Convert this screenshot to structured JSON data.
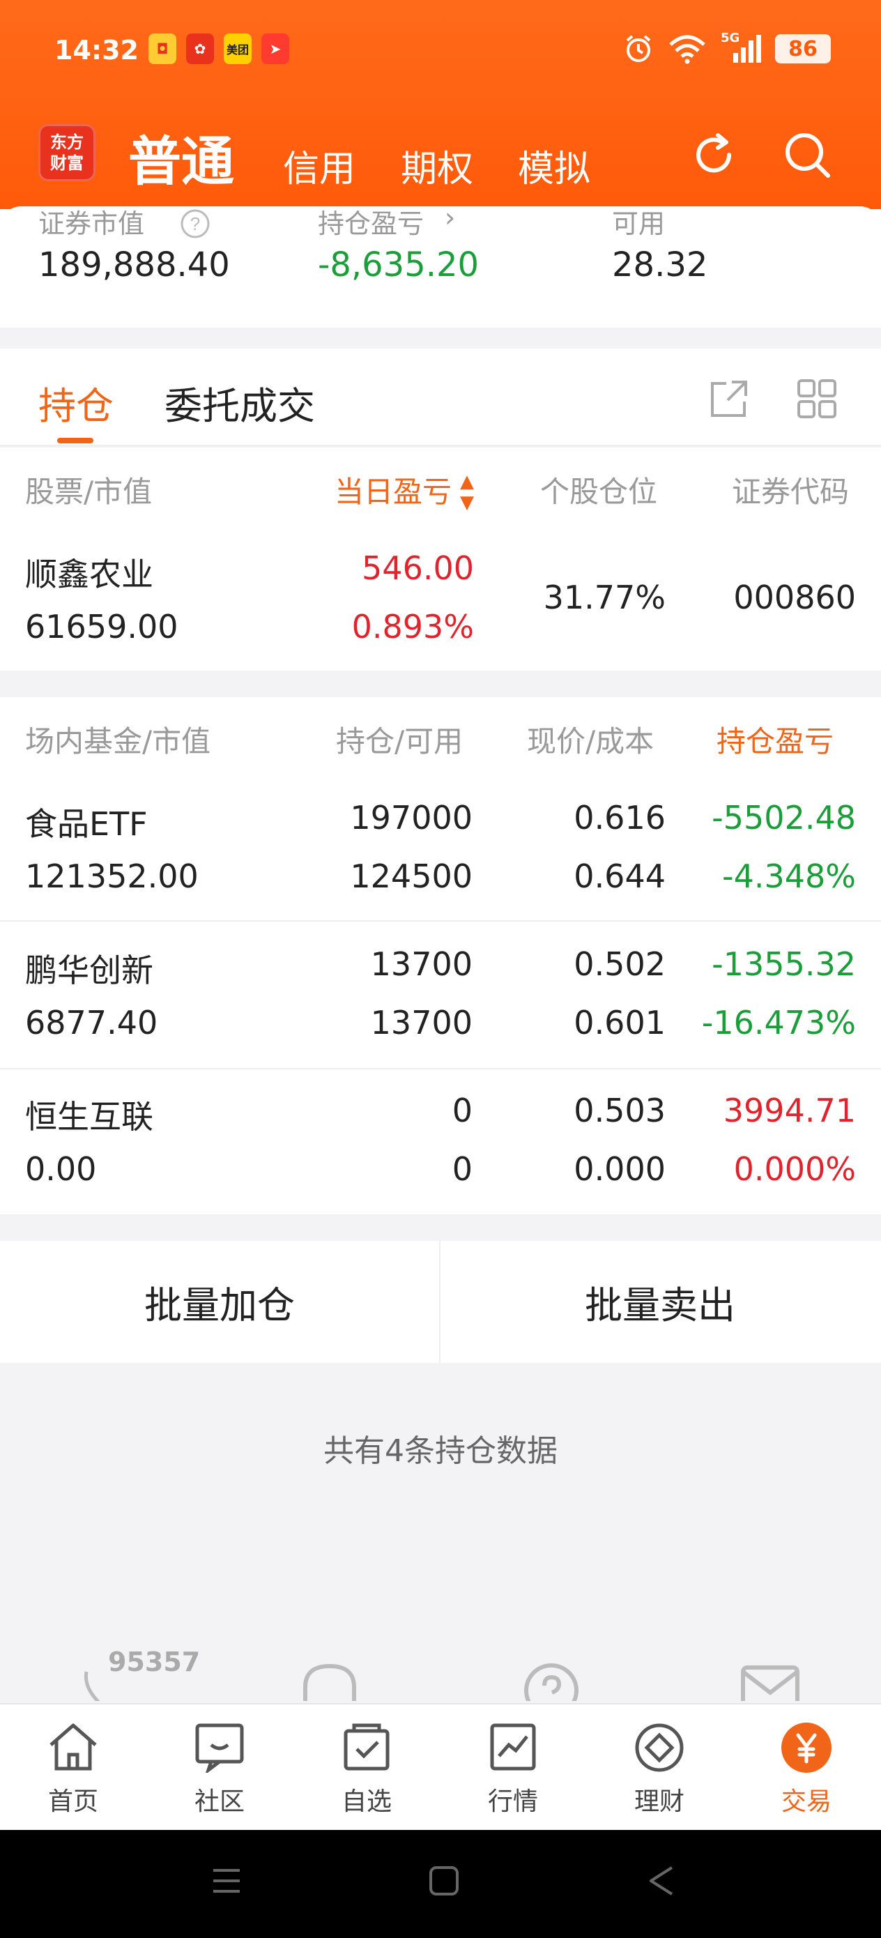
{
  "status_bar": {
    "time": "14:32",
    "network": "5G",
    "battery": "86",
    "apps": [
      "app-1",
      "app-2",
      "美团",
      "app-4"
    ]
  },
  "nav": {
    "logo": "东方财富",
    "main_tab": "普通",
    "tabs": [
      "信用",
      "期权",
      "模拟"
    ]
  },
  "summary": {
    "labels": [
      "证券市值",
      "持仓盈亏",
      "可用"
    ],
    "values": [
      "189,888.40",
      "-8,635.20",
      "28.32"
    ]
  },
  "tabs": {
    "holdings": "持仓",
    "orders": "委托成交"
  },
  "stocks": {
    "headers": [
      "股票/市值",
      "当日盈亏",
      "个股仓位",
      "证券代码"
    ],
    "rows": [
      {
        "name": "顺鑫农业",
        "market_value": "61659.00",
        "day_pnl": "546.00",
        "day_pnl_pct": "0.893%",
        "position_pct": "31.77%",
        "code": "000860"
      }
    ]
  },
  "funds": {
    "headers": [
      "场内基金/市值",
      "持仓/可用",
      "现价/成本",
      "持仓盈亏"
    ],
    "rows": [
      {
        "name": "食品ETF",
        "market_value": "121352.00",
        "holding": "197000",
        "available": "124500",
        "price": "0.616",
        "cost": "0.644",
        "pnl": "-5502.48",
        "pnl_pct": "-4.348%"
      },
      {
        "name": "鹏华创新",
        "market_value": "6877.40",
        "holding": "13700",
        "available": "13700",
        "price": "0.502",
        "cost": "0.601",
        "pnl": "-1355.32",
        "pnl_pct": "-16.473%"
      },
      {
        "name": "恒生互联",
        "market_value": "0.00",
        "holding": "0",
        "available": "0",
        "price": "0.503",
        "cost": "0.000",
        "pnl": "3994.71",
        "pnl_pct": "0.000%"
      }
    ]
  },
  "batch": {
    "add": "批量加仓",
    "sell": "批量卖出"
  },
  "record_count": "共有4条持仓数据",
  "service_number": "95357",
  "bottom_nav": {
    "items": [
      "首页",
      "社区",
      "自选",
      "行情",
      "理财",
      "交易"
    ],
    "active": "交易"
  },
  "colors": {
    "brand": "#ff5a0a",
    "accent": "#f06518",
    "up": "#e0242e",
    "down": "#1b9e3a"
  }
}
